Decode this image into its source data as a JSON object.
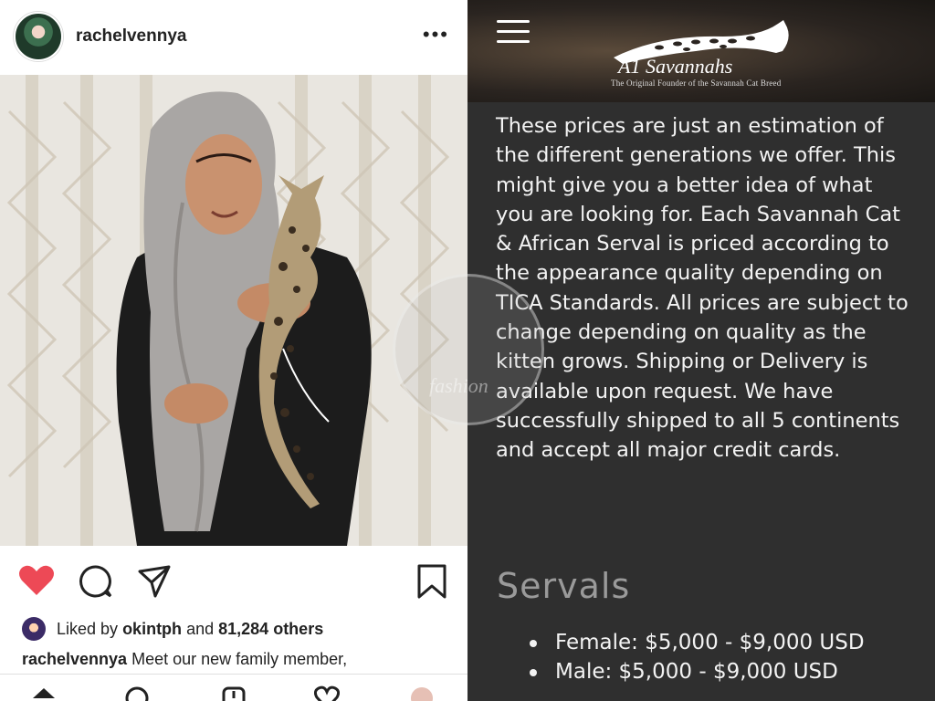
{
  "post": {
    "username": "rachelvennya",
    "more_label": "•••",
    "liked_by_prefix": "Liked by",
    "liked_by_user": "okintph",
    "liked_by_and": "and",
    "liked_by_count": "81,284 others",
    "caption_user": "rachelvennya",
    "caption_text": "Meet our new family member,"
  },
  "site": {
    "logo_name": "A1 Savannahs",
    "tagline": "The Original Founder of the Savannah Cat Breed",
    "paragraph": "These prices are just an estimation of the different generations we offer. This might give you a better idea of what you are looking for. Each Savannah Cat & African Serval is priced according to the appearance quality depending on TICA Standards. All prices are subject to change depending on quality as the kitten grows. Shipping or Delivery is available upon request. We have successfully shipped to all 5 continents and accept all major credit cards.",
    "section_title": "Servals",
    "prices": [
      "Female: $5,000 - $9,000 USD",
      "Male: $5,000 - $9,000 USD"
    ]
  },
  "watermark": "fashion",
  "colors": {
    "heart": "#ed4956",
    "site_bg": "#2f2f2f",
    "site_text": "#f3f3f3",
    "section_title": "#9a9a9a"
  }
}
